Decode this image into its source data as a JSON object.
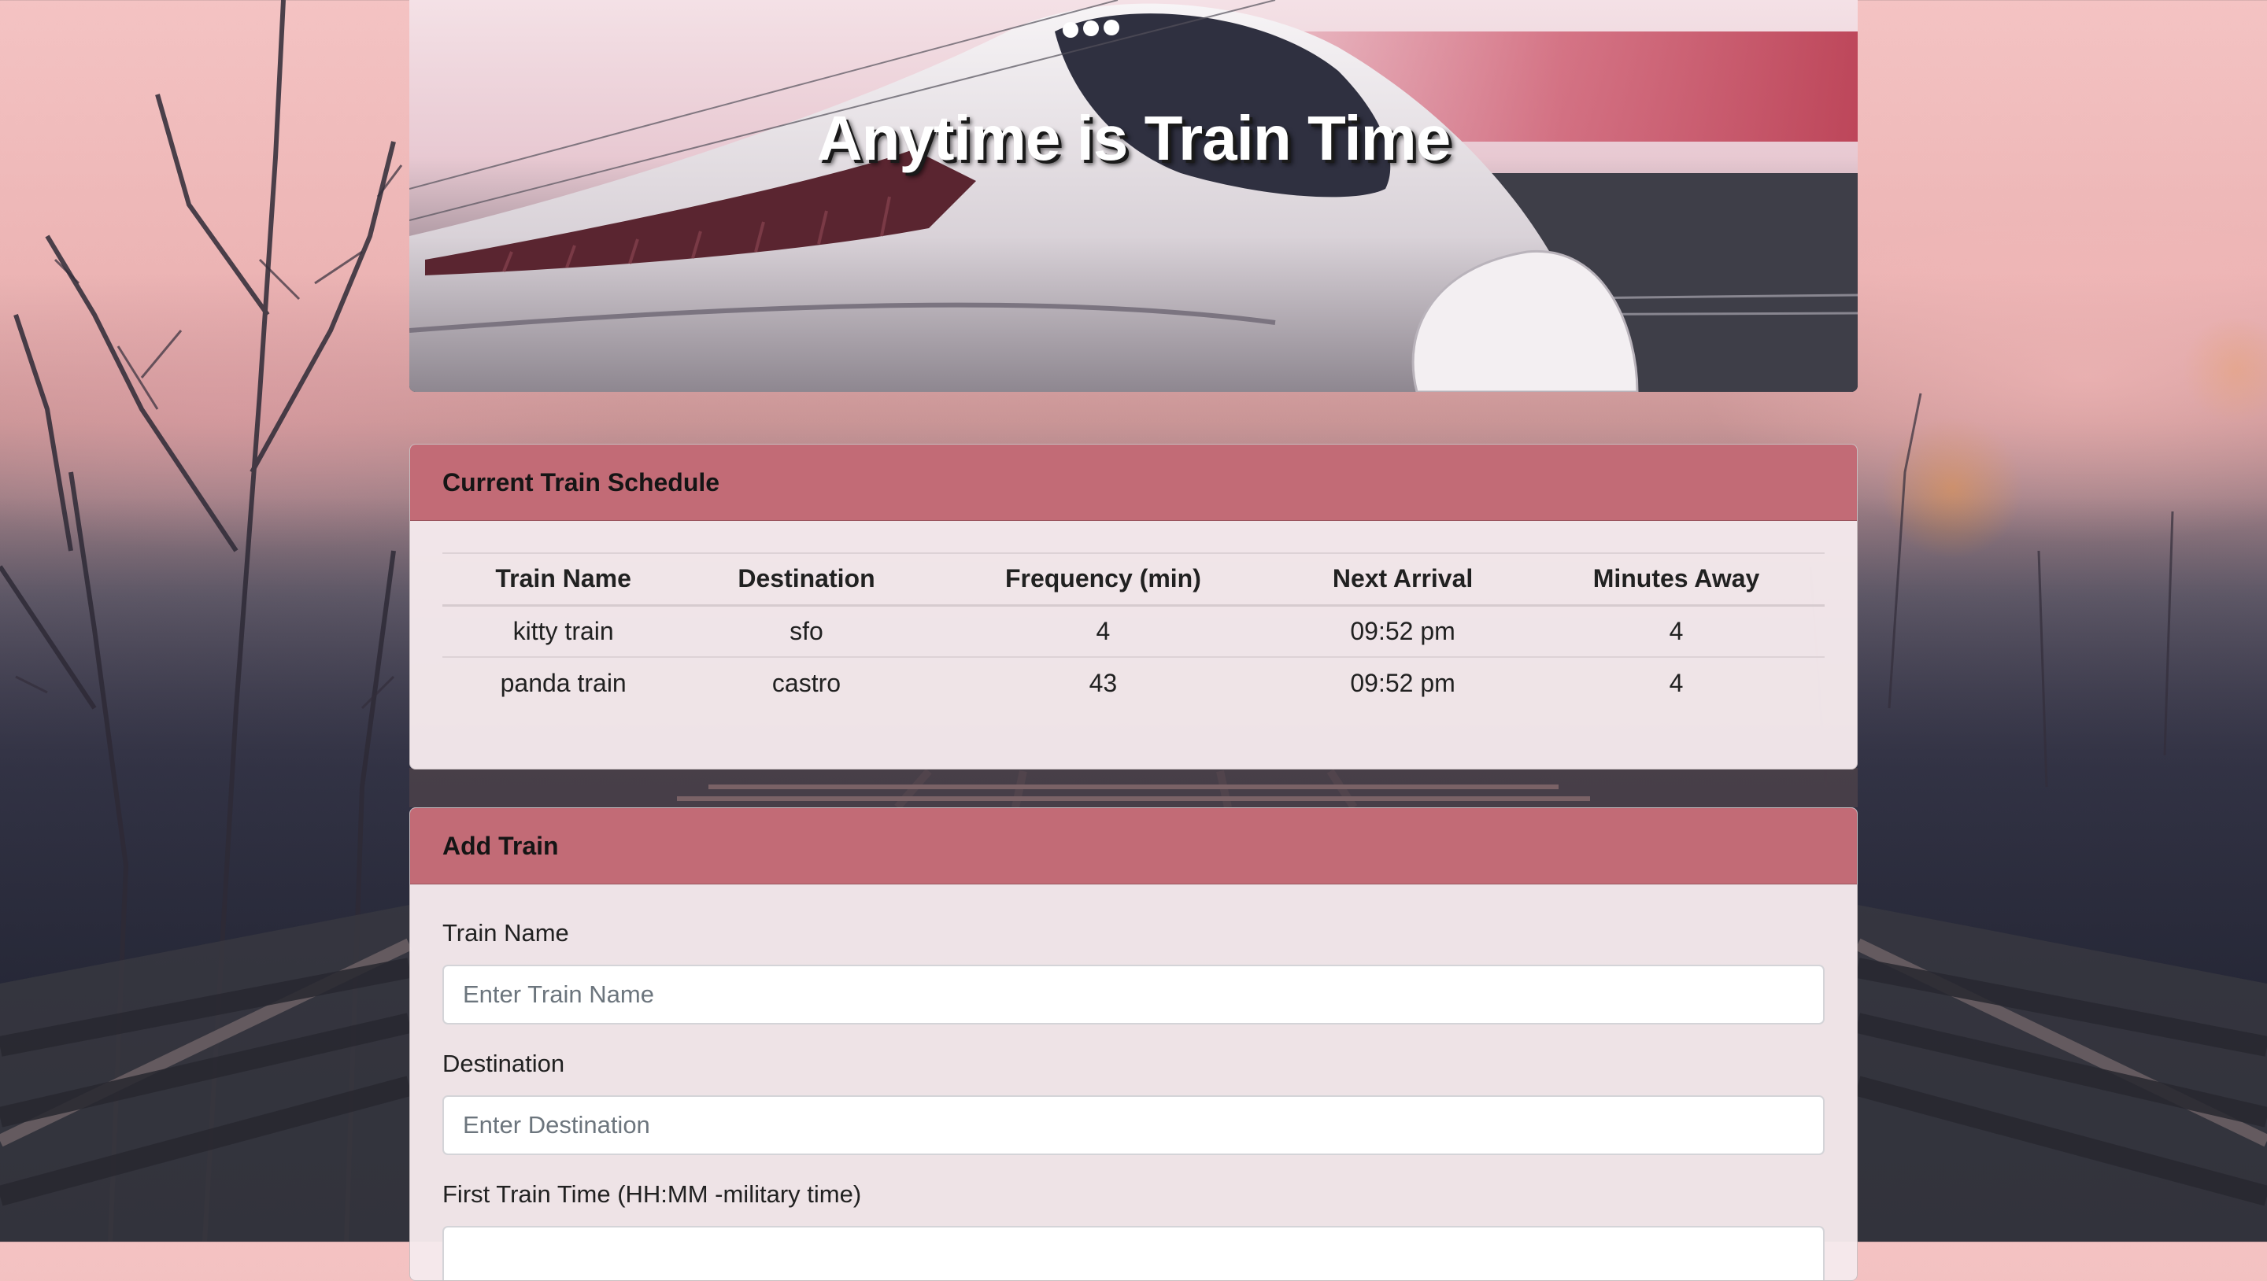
{
  "header": {
    "title": "Anytime is Train Time"
  },
  "schedule": {
    "heading": "Current Train Schedule",
    "columns": [
      "Train Name",
      "Destination",
      "Frequency (min)",
      "Next Arrival",
      "Minutes Away"
    ],
    "rows": [
      [
        "kitty train",
        "sfo",
        "4",
        "09:52 pm",
        "4"
      ],
      [
        "panda train",
        "castro",
        "43",
        "09:52 pm",
        "4"
      ]
    ]
  },
  "add_train": {
    "heading": "Add Train",
    "fields": [
      {
        "label": "Train Name",
        "placeholder": "Enter Train Name",
        "value": ""
      },
      {
        "label": "Destination",
        "placeholder": "Enter Destination",
        "value": ""
      },
      {
        "label": "First Train Time (HH:MM -military time)",
        "placeholder": "",
        "value": ""
      }
    ]
  },
  "colors": {
    "card_header": "#c26b76",
    "card_body": "#f5e9ec",
    "title_text": "#ffffff"
  },
  "icons": {
    "hero_image": "bullet-train-image",
    "background_image": "railway-forest-background"
  }
}
